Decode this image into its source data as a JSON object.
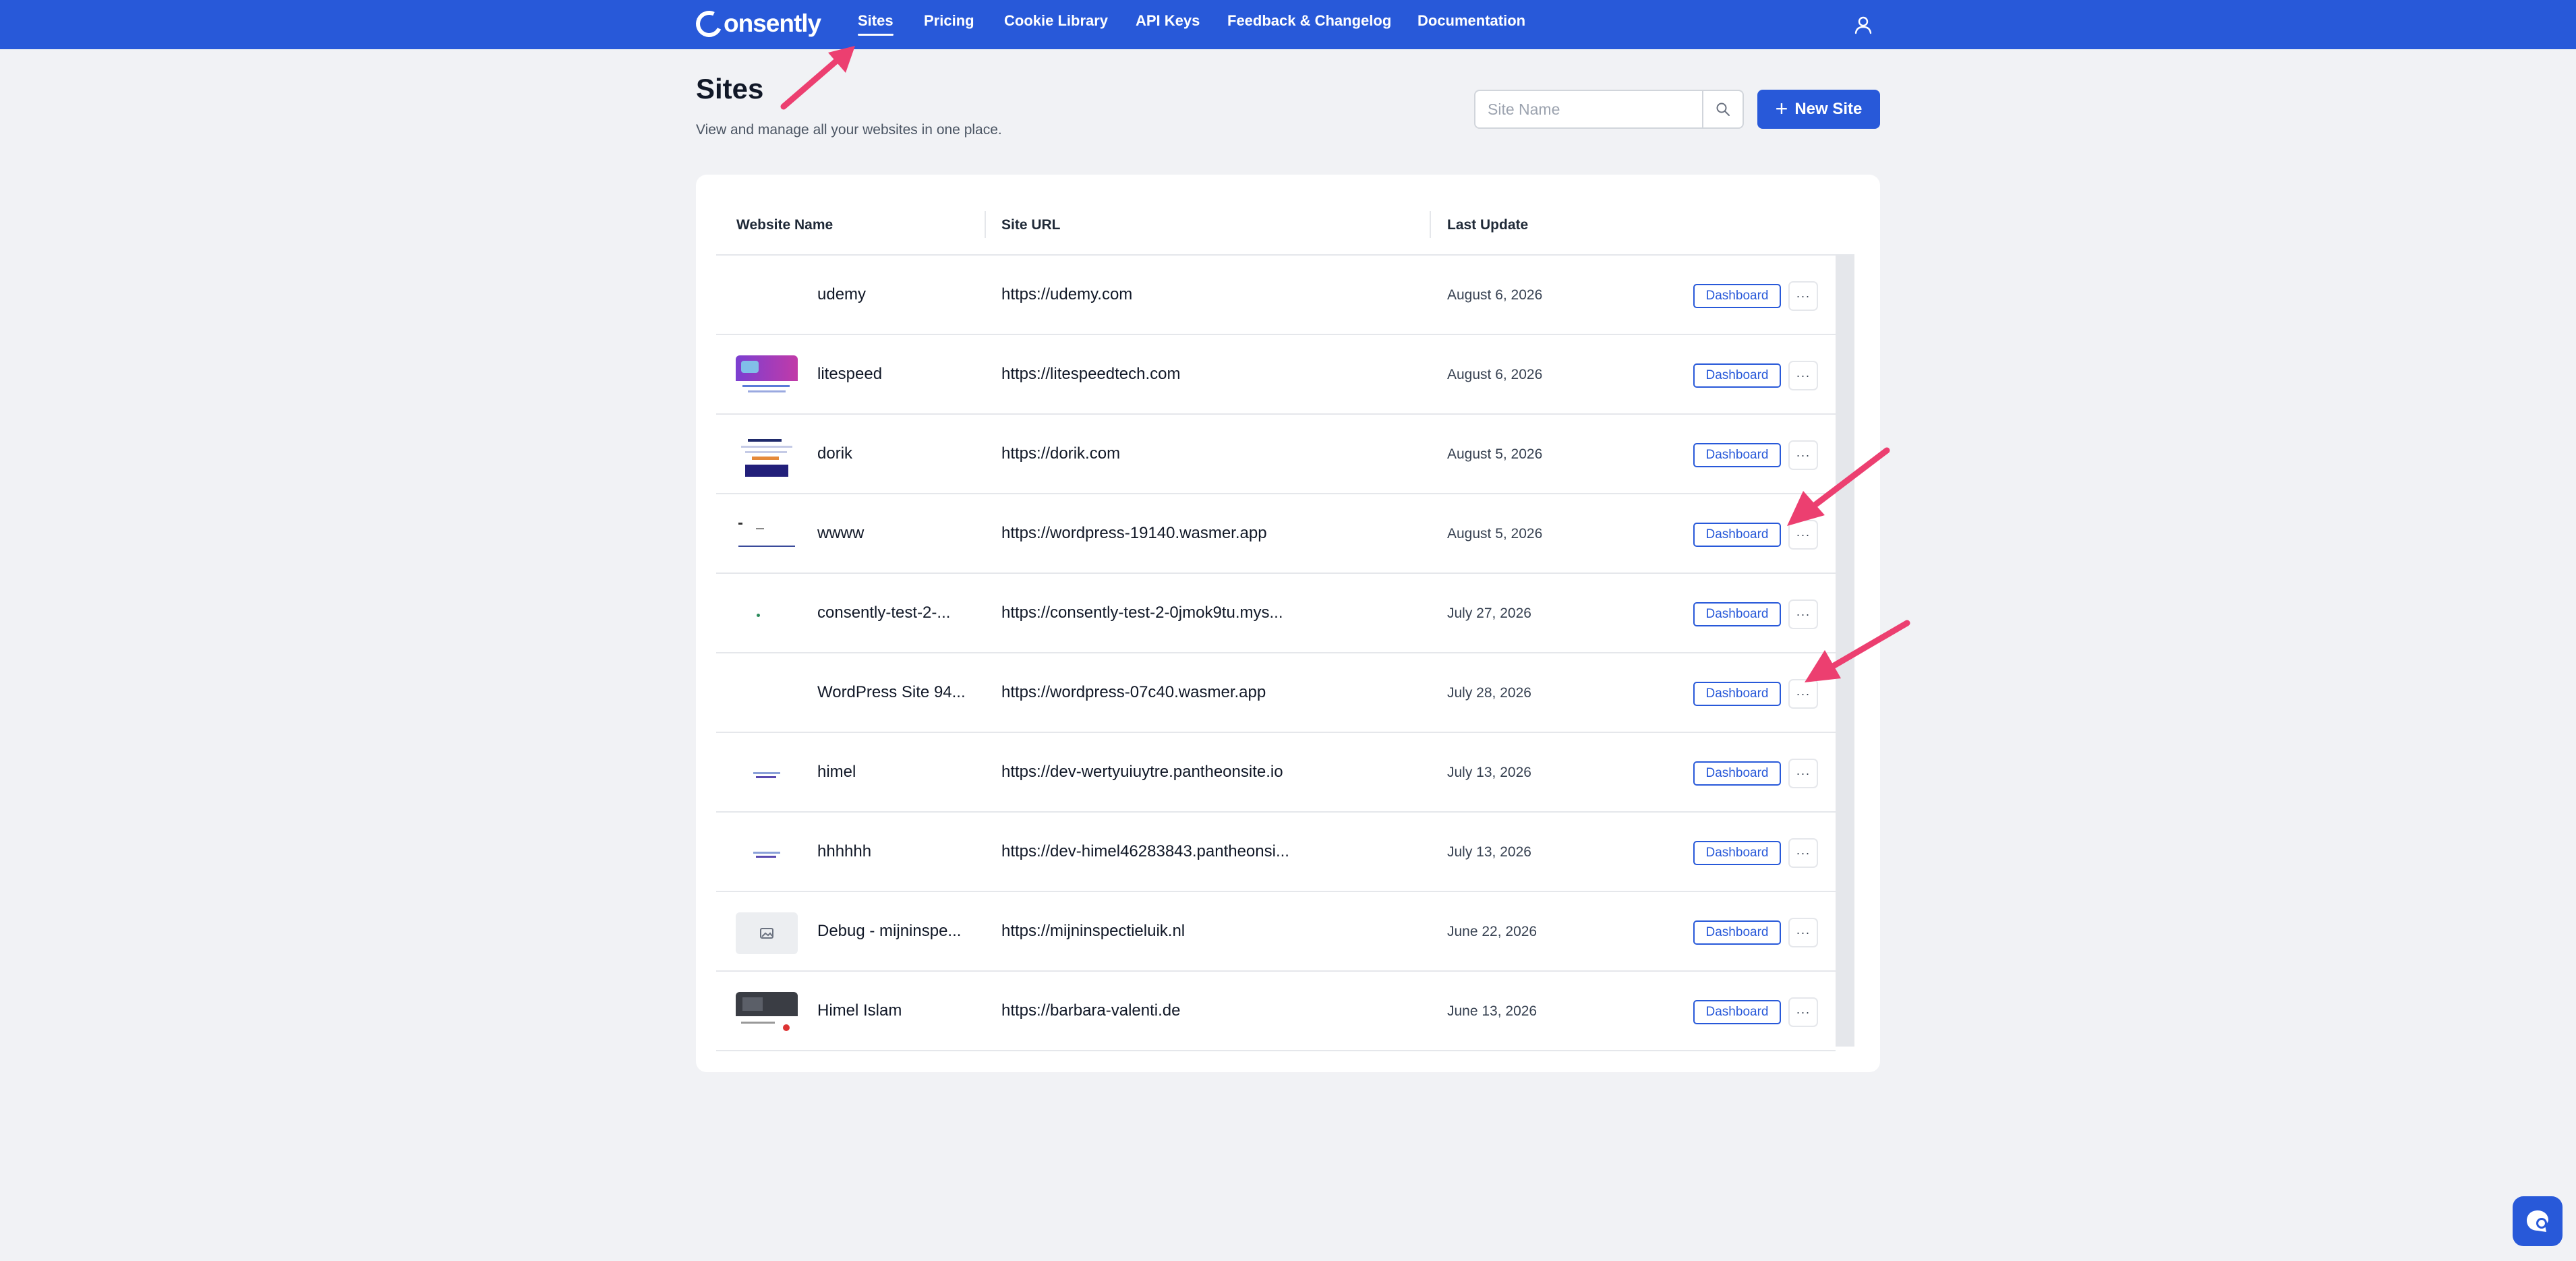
{
  "nav": {
    "logo": "onsently",
    "items": [
      {
        "label": "Sites",
        "active": true
      },
      {
        "label": "Pricing"
      },
      {
        "label": "Cookie Library"
      },
      {
        "label": "API Keys"
      },
      {
        "label": "Feedback & Changelog"
      },
      {
        "label": "Documentation"
      }
    ],
    "user_icon": "user-icon"
  },
  "header": {
    "title": "Sites",
    "subtitle": "View and manage all your websites in one place.",
    "search_placeholder": "Site Name",
    "new_site_label": "New Site"
  },
  "table": {
    "columns": [
      "Website Name",
      "Site URL",
      "Last Update"
    ],
    "rows": [
      {
        "name": "udemy",
        "url": "https://udemy.com",
        "date": "August 6, 2026",
        "action": "Dashboard",
        "more": "···",
        "thumb": "none"
      },
      {
        "name": "litespeed",
        "url": "https://litespeedtech.com",
        "date": "August 6, 2026",
        "action": "Dashboard",
        "more": "···",
        "thumb": "purple-banner"
      },
      {
        "name": "dorik",
        "url": "https://dorik.com",
        "date": "August 5, 2026",
        "action": "Dashboard",
        "more": "···",
        "thumb": "page-preview"
      },
      {
        "name": "wwww",
        "url": "https://wordpress-19140.wasmer.app",
        "date": "August 5, 2026",
        "action": "Dashboard",
        "more": "···",
        "thumb": "page-preview-light"
      },
      {
        "name": "consently-test-2-...",
        "url": "https://consently-test-2-0jmok9tu.mys...",
        "date": "July 27, 2026",
        "action": "Dashboard",
        "more": "···",
        "thumb": "dot"
      },
      {
        "name": "WordPress Site 94...",
        "url": "https://wordpress-07c40.wasmer.app",
        "date": "July 28, 2026",
        "action": "Dashboard",
        "more": "···",
        "thumb": "none"
      },
      {
        "name": "himel",
        "url": "https://dev-wertyuiuytre.pantheonsite.io",
        "date": "July 13, 2026",
        "action": "Dashboard",
        "more": "···",
        "thumb": "tiny-preview"
      },
      {
        "name": "hhhhhh",
        "url": "https://dev-himel46283843.pantheonsi...",
        "date": "July 13, 2026",
        "action": "Dashboard",
        "more": "···",
        "thumb": "tiny-preview"
      },
      {
        "name": "Debug - mijninspe...",
        "url": "https://mijninspectieluik.nl",
        "date": "June 22, 2026",
        "action": "Dashboard",
        "more": "···",
        "thumb": "image-placeholder"
      },
      {
        "name": "Himel Islam",
        "url": "https://barbara-valenti.de",
        "date": "June 13, 2026",
        "action": "Dashboard",
        "more": "···",
        "thumb": "dark-preview"
      }
    ]
  },
  "colors": {
    "brand": "#2859d9",
    "annotation_arrow": "#ec3f70"
  }
}
